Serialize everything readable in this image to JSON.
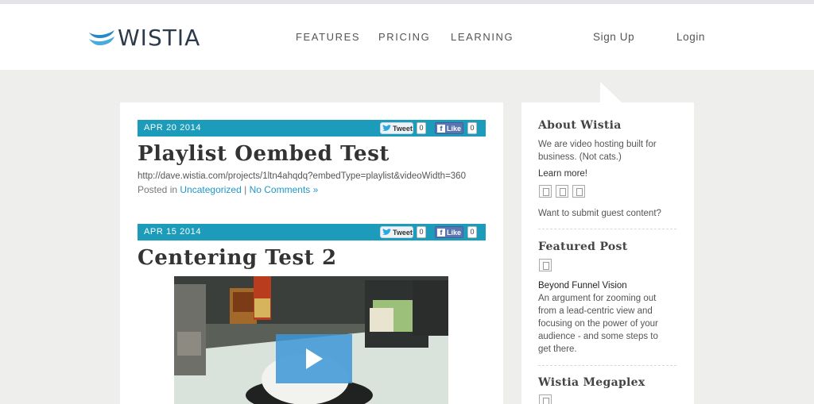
{
  "brand": {
    "logo_text": "WISTIA",
    "accent": "#1c9bbb",
    "logo_color": "#2a88c8"
  },
  "nav": {
    "features": "FEATURES",
    "pricing": "PRICING",
    "learning": "LEARNING",
    "signup": "Sign Up",
    "login": "Login"
  },
  "posts": [
    {
      "date": "APR 20  2014",
      "tweet_label": "Tweet",
      "tweet_count": "0",
      "like_label": "Like",
      "like_count": "0",
      "title": "Playlist Oembed Test",
      "url": "http://dave.wistia.com/projects/1ltn4ahqdq?embedType=playlist&videoWidth=360",
      "posted_in": "Posted in",
      "category": "Uncategorized",
      "separator": "|",
      "comments": "No Comments »"
    },
    {
      "date": "APR 15  2014",
      "tweet_label": "Tweet",
      "tweet_count": "0",
      "like_label": "Like",
      "like_count": "0",
      "title": "Centering Test 2"
    }
  ],
  "sidebar": {
    "about": {
      "heading": "About Wistia",
      "text": "We are video hosting built for business. (Not cats.)",
      "learn_more": "Learn more!",
      "guest": "Want to submit guest content?"
    },
    "featured": {
      "heading": "Featured Post",
      "post_title": "Beyond Funnel Vision",
      "post_text": "An argument for zooming out from a lead-centric view and focusing on the power of your audience - and some steps to get there."
    },
    "megaplex": {
      "heading": "Wistia Megaplex"
    }
  }
}
